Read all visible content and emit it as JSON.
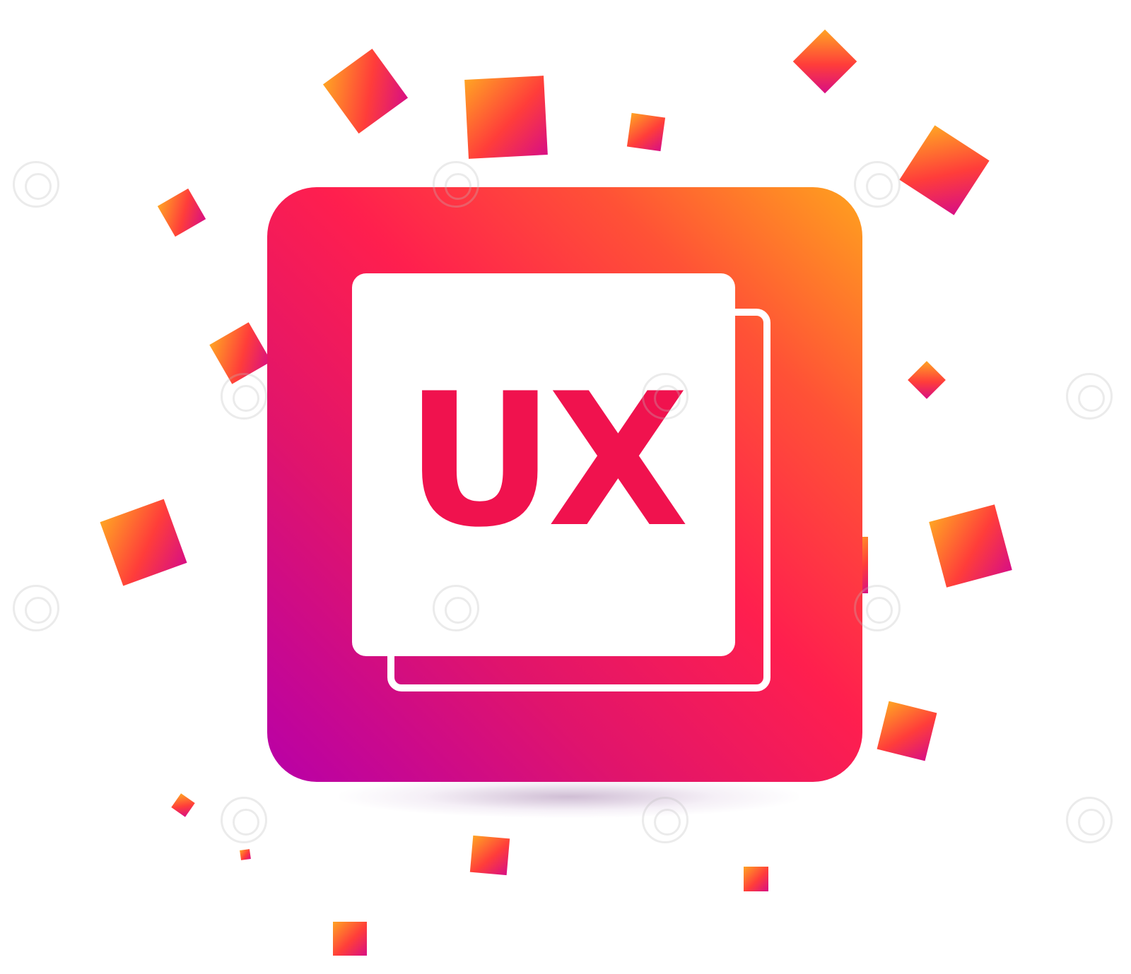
{
  "icon": {
    "label": "UX",
    "name": "ux-icon",
    "gradient": [
      "#ffa21e",
      "#ff1f4e",
      "#b800a8"
    ],
    "text_color": "#f0124e"
  },
  "background": {
    "color": "#ffffff"
  },
  "decorations": {
    "confetti_name": "confetti-square",
    "watermark_name": "watermark-spiral-icon"
  }
}
